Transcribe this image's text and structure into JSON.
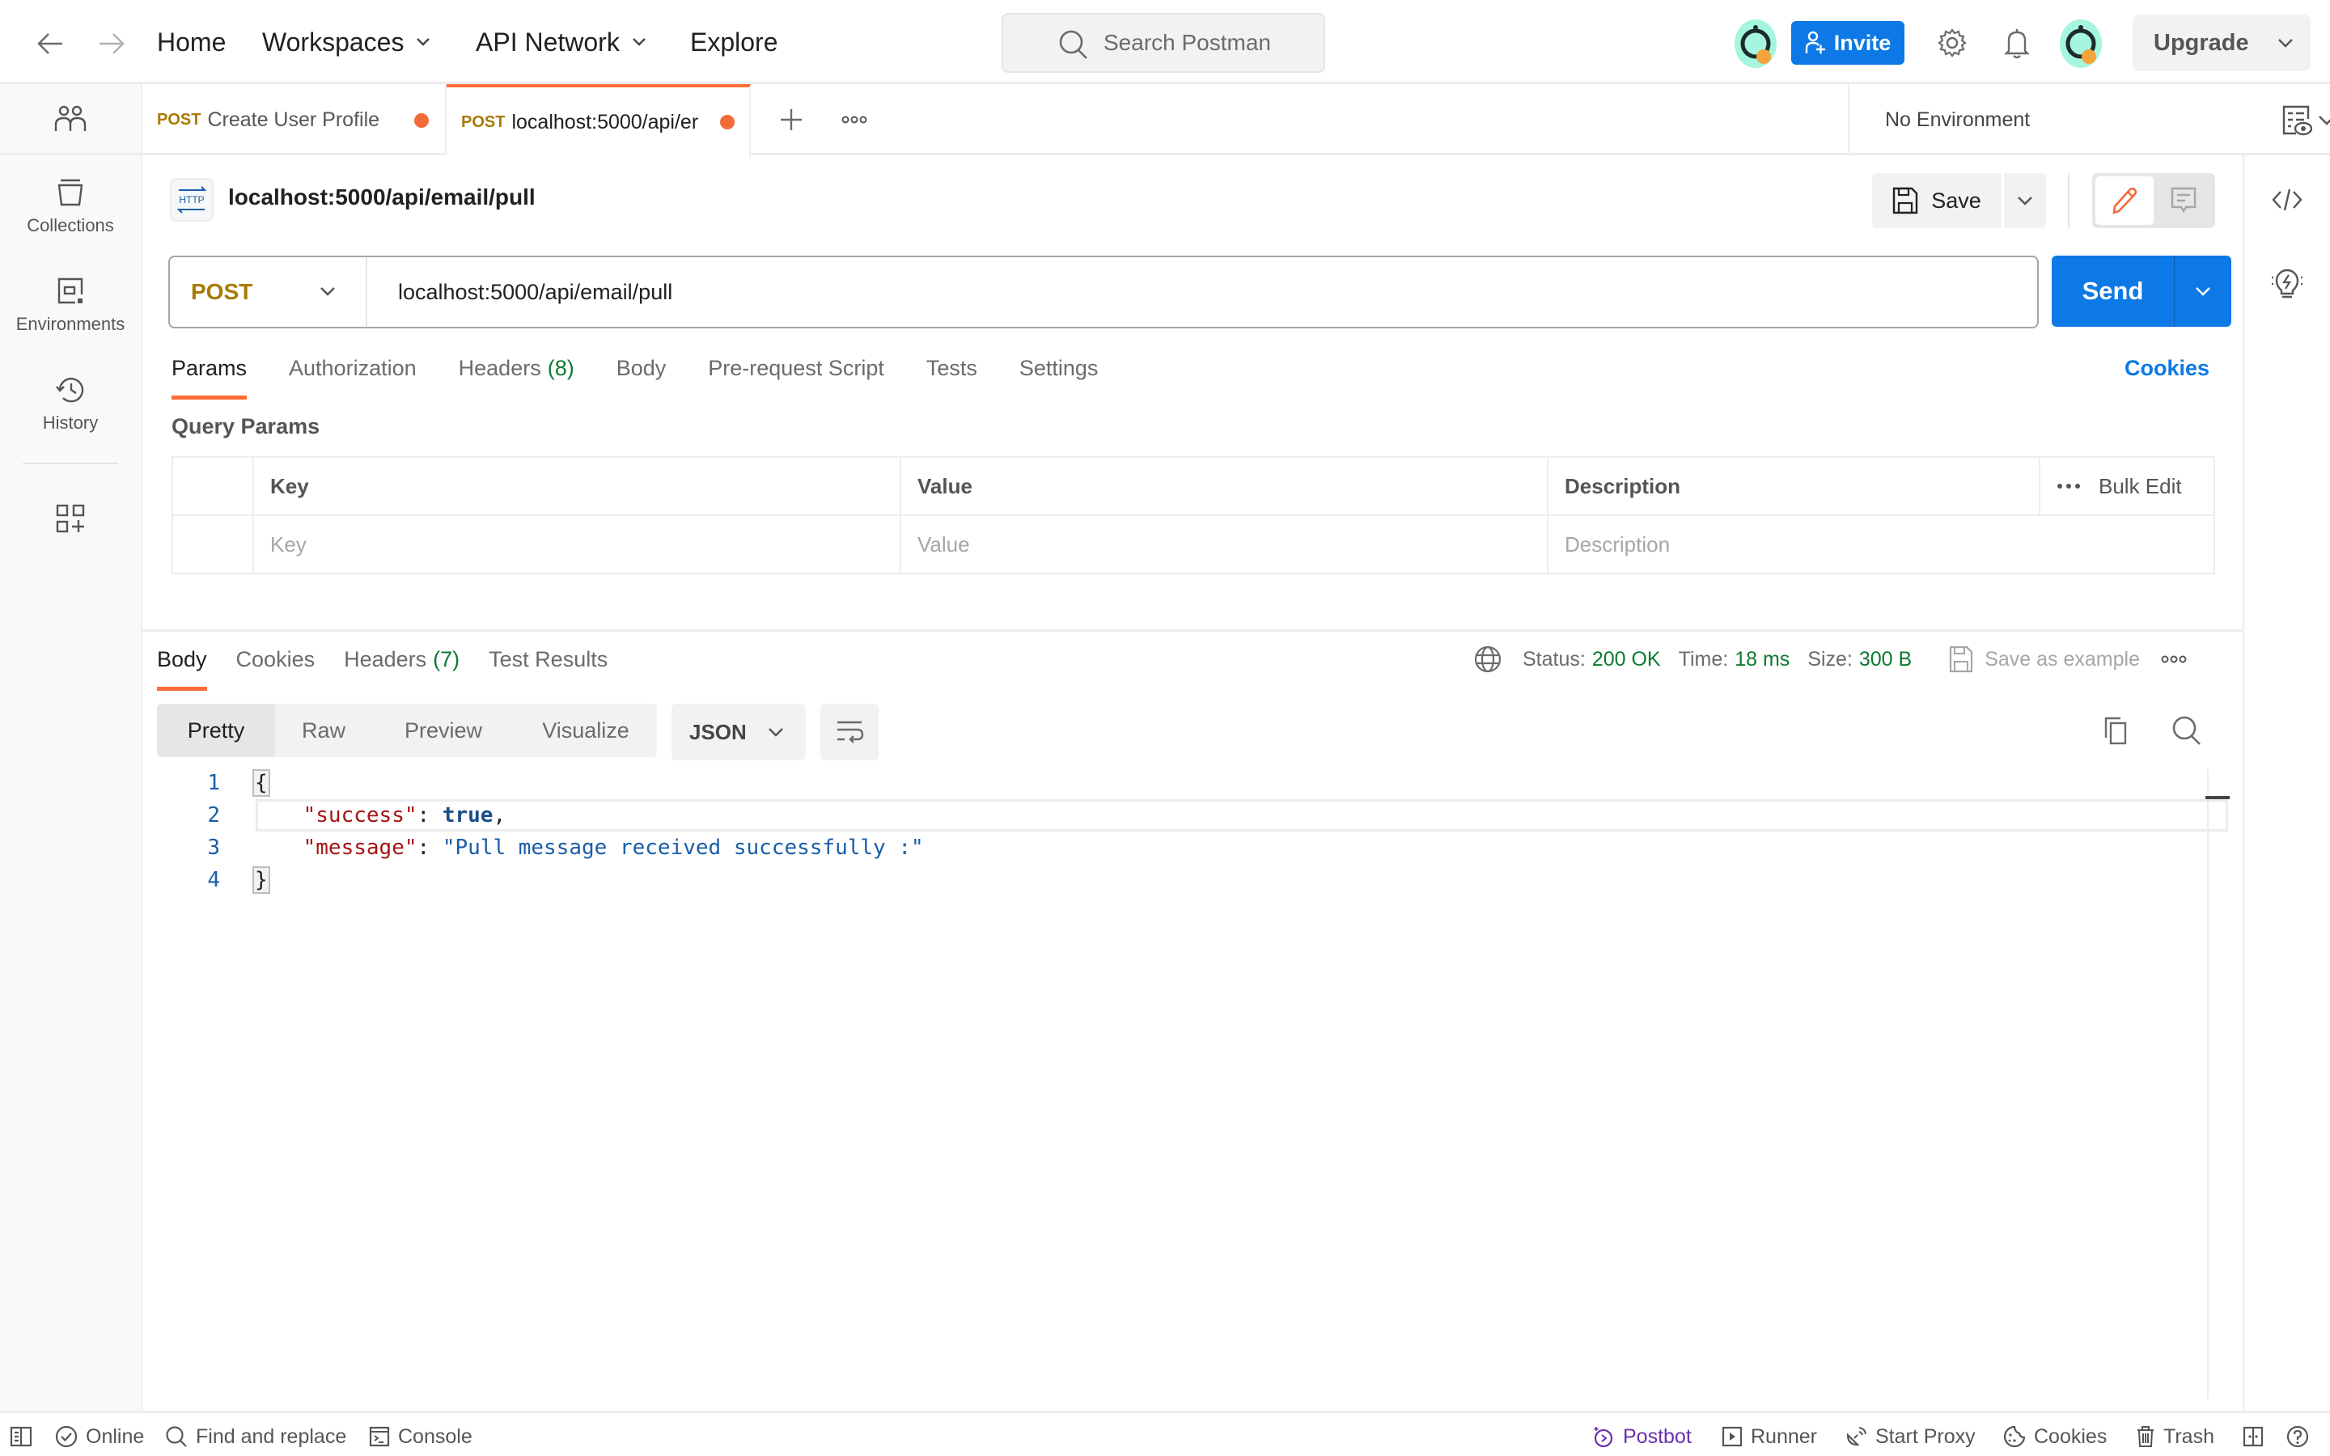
{
  "header": {
    "nav": [
      "Home",
      "Workspaces",
      "API Network",
      "Explore"
    ],
    "search_placeholder": "Search Postman",
    "invite_label": "Invite",
    "upgrade_label": "Upgrade",
    "brand_color": "#ff6c37",
    "accent_color": "#0c79e6"
  },
  "sidebar": {
    "items": [
      {
        "label": "Collections",
        "icon": "collections-icon"
      },
      {
        "label": "Environments",
        "icon": "environments-icon"
      },
      {
        "label": "History",
        "icon": "history-icon"
      }
    ]
  },
  "tabs": [
    {
      "method": "POST",
      "title": "Create User Profile",
      "unsaved": true,
      "active": false
    },
    {
      "method": "POST",
      "title": "localhost:5000/api/er",
      "unsaved": true,
      "active": true
    }
  ],
  "environment": {
    "selected": "No Environment"
  },
  "request": {
    "title": "localhost:5000/api/email/pull",
    "save_label": "Save",
    "method": "POST",
    "url": "localhost:5000/api/email/pull",
    "send_label": "Send",
    "tabs": [
      {
        "label": "Params",
        "count": null,
        "active": true
      },
      {
        "label": "Authorization",
        "count": null
      },
      {
        "label": "Headers",
        "count": "(8)"
      },
      {
        "label": "Body",
        "count": null
      },
      {
        "label": "Pre-request Script",
        "count": null
      },
      {
        "label": "Tests",
        "count": null
      },
      {
        "label": "Settings",
        "count": null
      }
    ],
    "cookies_label": "Cookies",
    "query_params": {
      "title": "Query Params",
      "columns": [
        "Key",
        "Value",
        "Description"
      ],
      "bulk_edit_label": "Bulk Edit",
      "placeholders": {
        "key": "Key",
        "value": "Value",
        "description": "Description"
      }
    }
  },
  "response": {
    "tabs": [
      {
        "label": "Body",
        "count": null,
        "active": true
      },
      {
        "label": "Cookies",
        "count": null
      },
      {
        "label": "Headers",
        "count": "(7)"
      },
      {
        "label": "Test Results",
        "count": null
      }
    ],
    "status_label": "Status:",
    "status": "200 OK",
    "time_label": "Time:",
    "time": "18 ms",
    "size_label": "Size:",
    "size": "300 B",
    "save_example_label": "Save as example",
    "views": [
      "Pretty",
      "Raw",
      "Preview",
      "Visualize"
    ],
    "active_view": "Pretty",
    "format": "JSON",
    "body_lines": [
      {
        "n": "1",
        "text": "{"
      },
      {
        "n": "2",
        "key": "\"success\"",
        "value": "true",
        "suffix": ","
      },
      {
        "n": "3",
        "key": "\"message\"",
        "value": "\"Pull message received successfully :\"",
        "suffix": ""
      },
      {
        "n": "4",
        "text": "}"
      }
    ]
  },
  "statusbar": {
    "left": [
      "Online",
      "Find and replace",
      "Console"
    ],
    "right": [
      "Postbot",
      "Runner",
      "Start Proxy",
      "Cookies",
      "Trash"
    ]
  }
}
